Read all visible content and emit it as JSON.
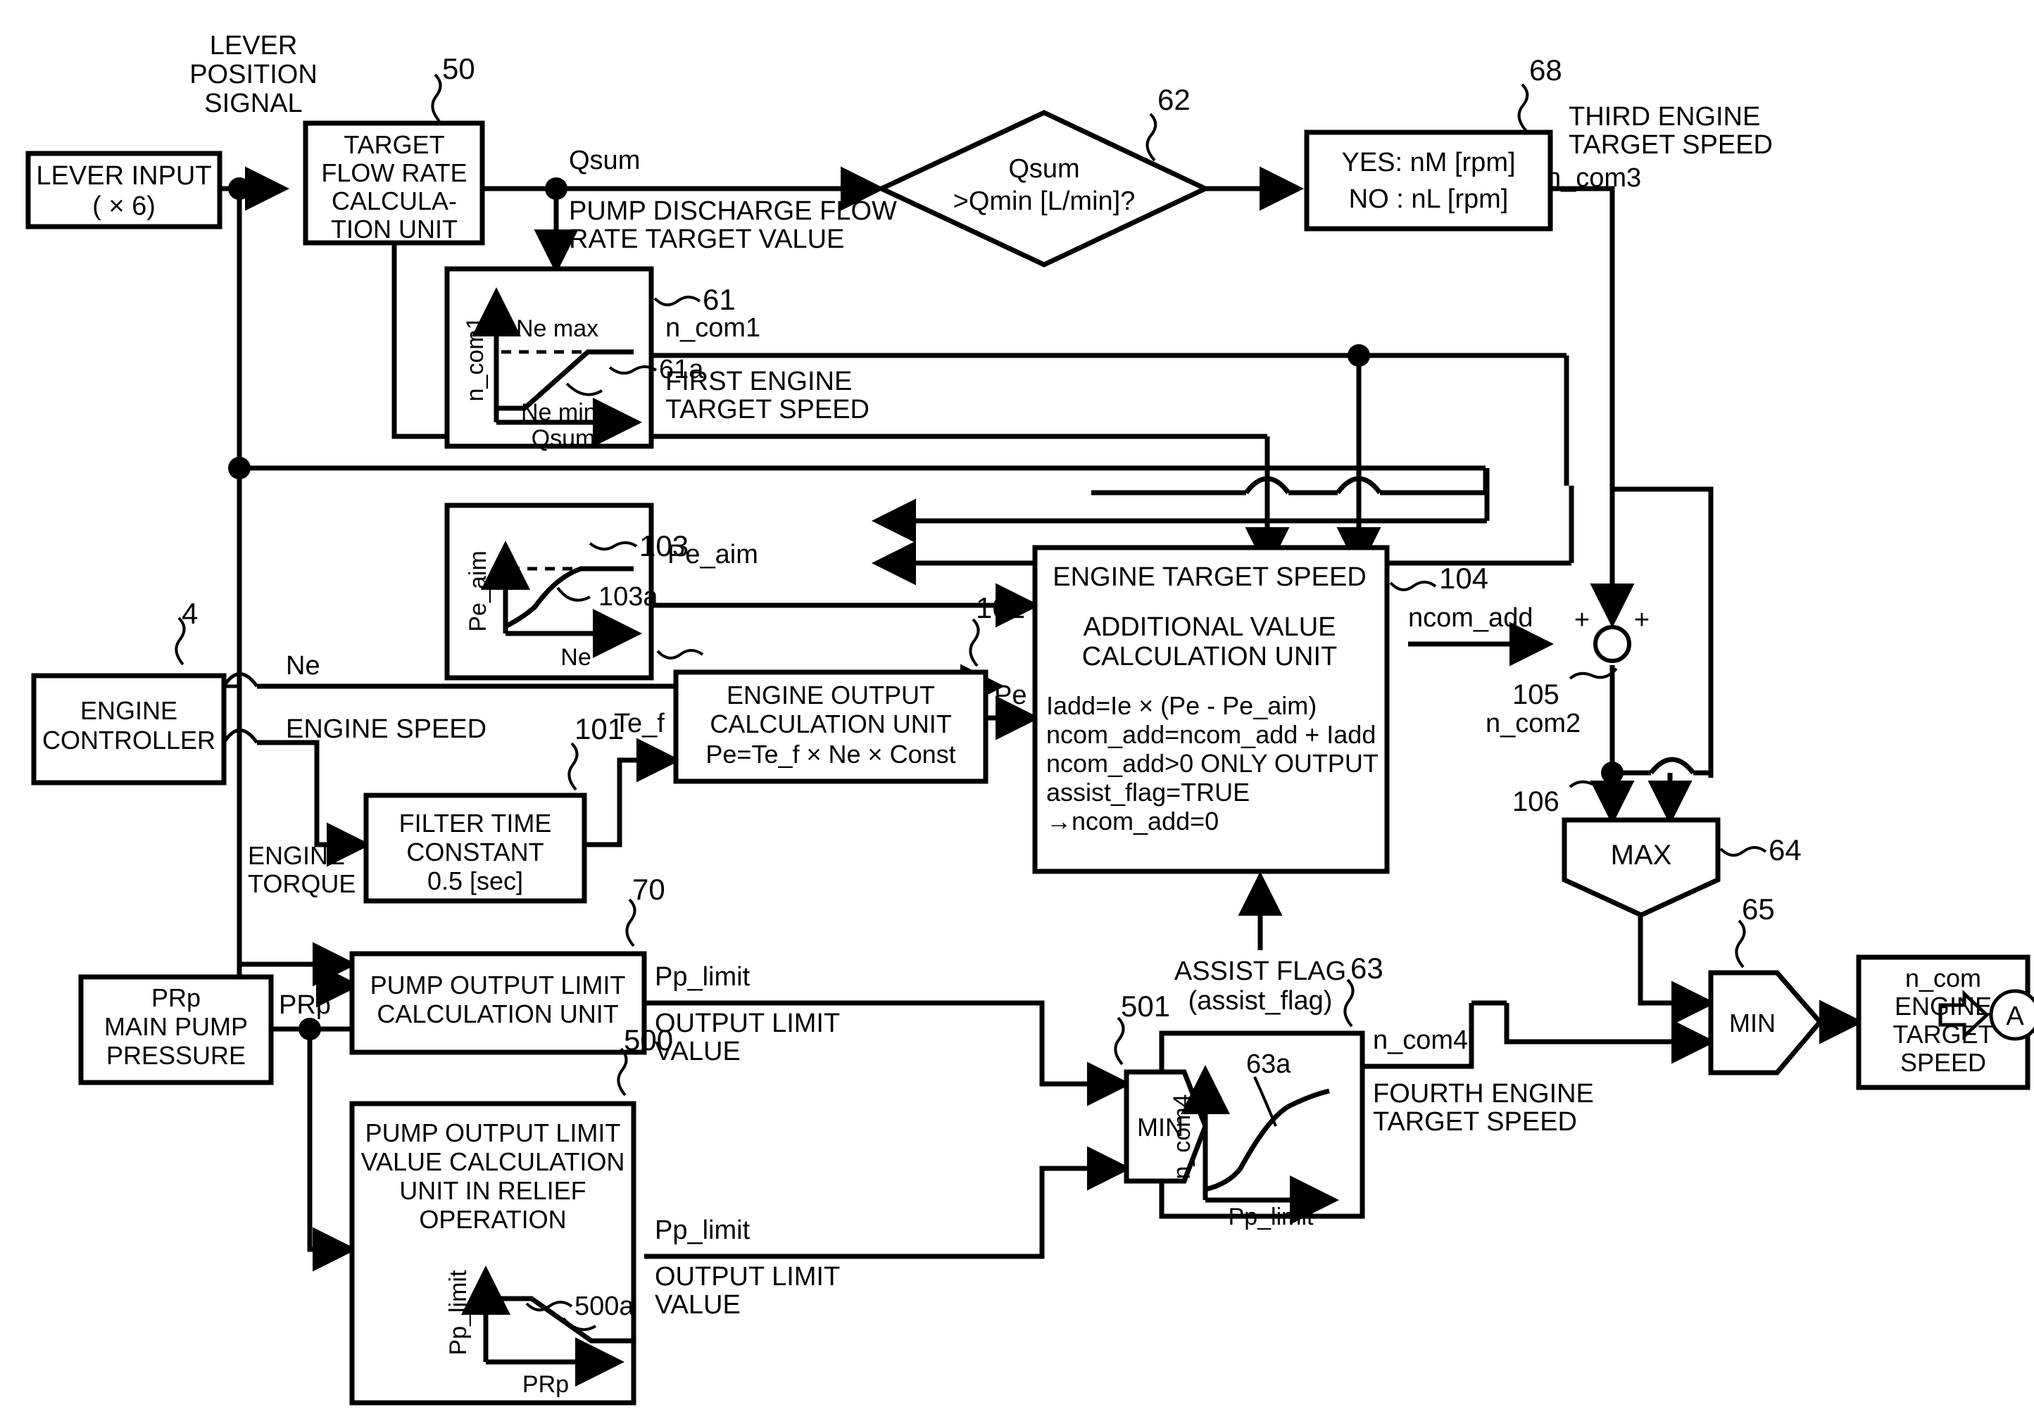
{
  "figure": {
    "type": "engine target speed control block diagram",
    "exit_marker": "A"
  },
  "blocks": {
    "lever_input": {
      "label_line1": "LEVER INPUT",
      "label_line2": "( × 6)"
    },
    "target_flow": {
      "line1": "TARGET",
      "line2": "FLOW RATE",
      "line3": "CALCULA-",
      "line4": "TION UNIT",
      "ref": "50"
    },
    "decision": {
      "line1": "Qsum",
      "line2": ">Qmin [L/min]?",
      "ref": "62"
    },
    "yesno": {
      "line1": "YES: nM [rpm]",
      "line2": "NO : nL [rpm]",
      "ref": "68"
    },
    "graph61": {
      "ref": "61",
      "curve_ref": "61a",
      "ylabel": "n_com1",
      "xlabel": "Qsum",
      "top_label": "Ne max",
      "bottom_label": "Ne min"
    },
    "graph103": {
      "ref": "103",
      "curve_ref": "103a",
      "ylabel": "Pe_aim",
      "xlabel": "Ne"
    },
    "engine_controller": {
      "line1": "ENGINE",
      "line2": "CONTROLLER",
      "ref": "4"
    },
    "filter": {
      "line1": "FILTER TIME",
      "line2": "CONSTANT",
      "line3": "0.5 [sec]",
      "ref": "101"
    },
    "engine_output": {
      "line1": "ENGINE OUTPUT",
      "line2": "CALCULATION UNIT",
      "line3": "Pe=Te_f × Ne × Const",
      "ref": "102"
    },
    "additional_value": {
      "title1": "ENGINE TARGET SPEED",
      "title2": "ADDITIONAL VALUE",
      "title3": "CALCULATION UNIT",
      "ref": "104",
      "formulas": [
        "Iadd=Ie × (Pe - Pe_aim)",
        "ncom_add=ncom_add + Iadd",
        "ncom_add>0 ONLY OUTPUT",
        "assist_flag=TRUE",
        "→ncom_add=0"
      ]
    },
    "pump_limit": {
      "line1": "PUMP OUTPUT LIMIT",
      "line2": "CALCULATION UNIT",
      "ref": "70"
    },
    "pump_limit_relief": {
      "line1": "PUMP OUTPUT LIMIT",
      "line2": "VALUE CALCULATION",
      "line3": "UNIT IN RELIEF",
      "line4": "OPERATION",
      "ref": "500",
      "curve_ref": "500a",
      "ylabel": "Pp_limit",
      "xlabel": "PRp"
    },
    "prp": {
      "line1": "PRp",
      "line2": "MAIN PUMP",
      "line3": "PRESSURE"
    },
    "graph63": {
      "ref": "63",
      "curve_ref": "63a",
      "ylabel": "n_com4",
      "xlabel": "Pp_limit"
    },
    "min501": {
      "label": "MIN",
      "ref": "501"
    },
    "max64": {
      "label": "MAX",
      "ref": "64"
    },
    "min65": {
      "label": "MIN",
      "ref": "65"
    },
    "ncom_out": {
      "line1": "n_com",
      "line2": "ENGINE",
      "line3": "TARGET",
      "line4": "SPEED"
    },
    "sum105": {
      "ref": "105",
      "sign_left": "+",
      "sign_right": "+"
    },
    "node106": {
      "ref": "106"
    }
  },
  "labels": {
    "lever_position_signal_1": "LEVER",
    "lever_position_signal_2": "POSITION",
    "lever_position_signal_3": "SIGNAL",
    "qsum": "Qsum",
    "pump_discharge_1": "PUMP DISCHARGE FLOW",
    "pump_discharge_2": "RATE TARGET VALUE",
    "third_engine_1": "THIRD ENGINE",
    "third_engine_2": "TARGET SPEED",
    "n_com3": "n_com3",
    "n_com1": "n_com1",
    "first_engine_1": "FIRST ENGINE",
    "first_engine_2": "TARGET SPEED",
    "pe_aim": "Pe_aim",
    "ne": "Ne",
    "engine_speed": "ENGINE SPEED",
    "engine_torque_1": "ENGINE",
    "engine_torque_2": "TORQUE",
    "te_f": "Te_f",
    "pe": "Pe",
    "ncom_add": "ncom_add",
    "n_com2": "n_com2",
    "assist_flag_1": "ASSIST FLAG",
    "assist_flag_2": "(assist_flag)",
    "pp_limit": "Pp_limit",
    "output_limit_1": "OUTPUT LIMIT",
    "output_limit_2": "VALUE",
    "prp_sig": "PRp",
    "n_com4": "n_com4",
    "fourth_engine_1": "FOURTH ENGINE",
    "fourth_engine_2": "TARGET SPEED"
  }
}
